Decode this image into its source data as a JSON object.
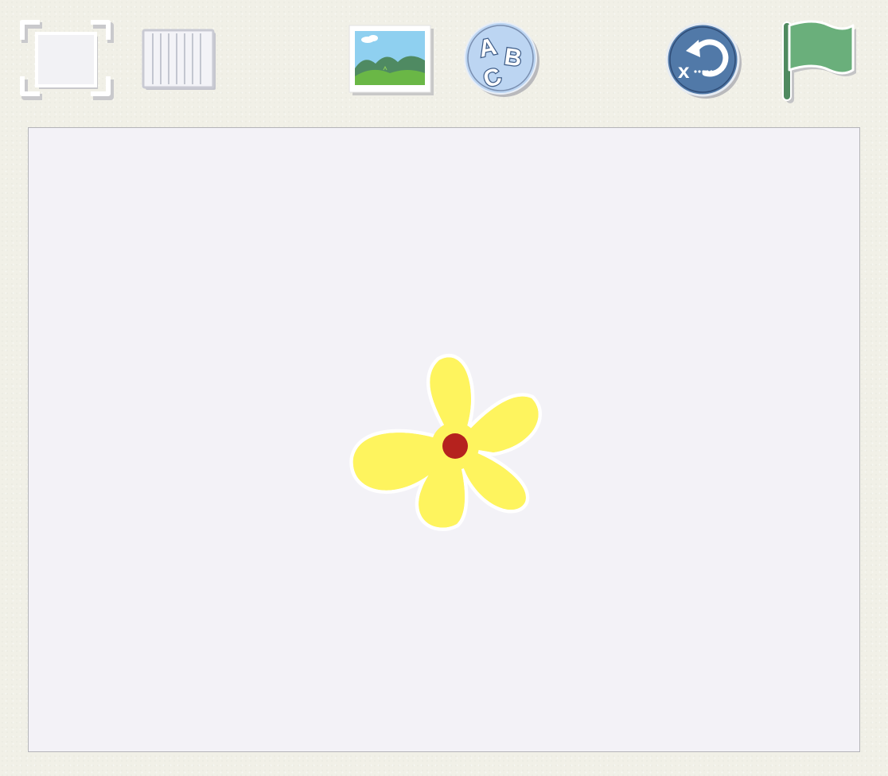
{
  "toolbar": {
    "buttons": [
      {
        "icon": "fullscreen-icon",
        "label": ""
      },
      {
        "icon": "grid-icon",
        "label": ""
      },
      {
        "icon": "background-image-icon",
        "label": ""
      },
      {
        "icon": "abc-text-icon",
        "letters": [
          "A",
          "B",
          "C"
        ]
      },
      {
        "icon": "reset-icon",
        "glyph": "x"
      },
      {
        "icon": "green-flag-icon",
        "label": ""
      }
    ]
  },
  "stage": {
    "background_color": "#f3f2f7",
    "sprites": [
      {
        "name": "flower",
        "petal_color": "#fef45e",
        "center_color": "#b5221e"
      }
    ]
  },
  "colors": {
    "page_background": "#f1f0e7",
    "flag_green": "#6aaf7b",
    "reset_blue": "#5179a8",
    "abc_blue": "#bcd5f2"
  }
}
